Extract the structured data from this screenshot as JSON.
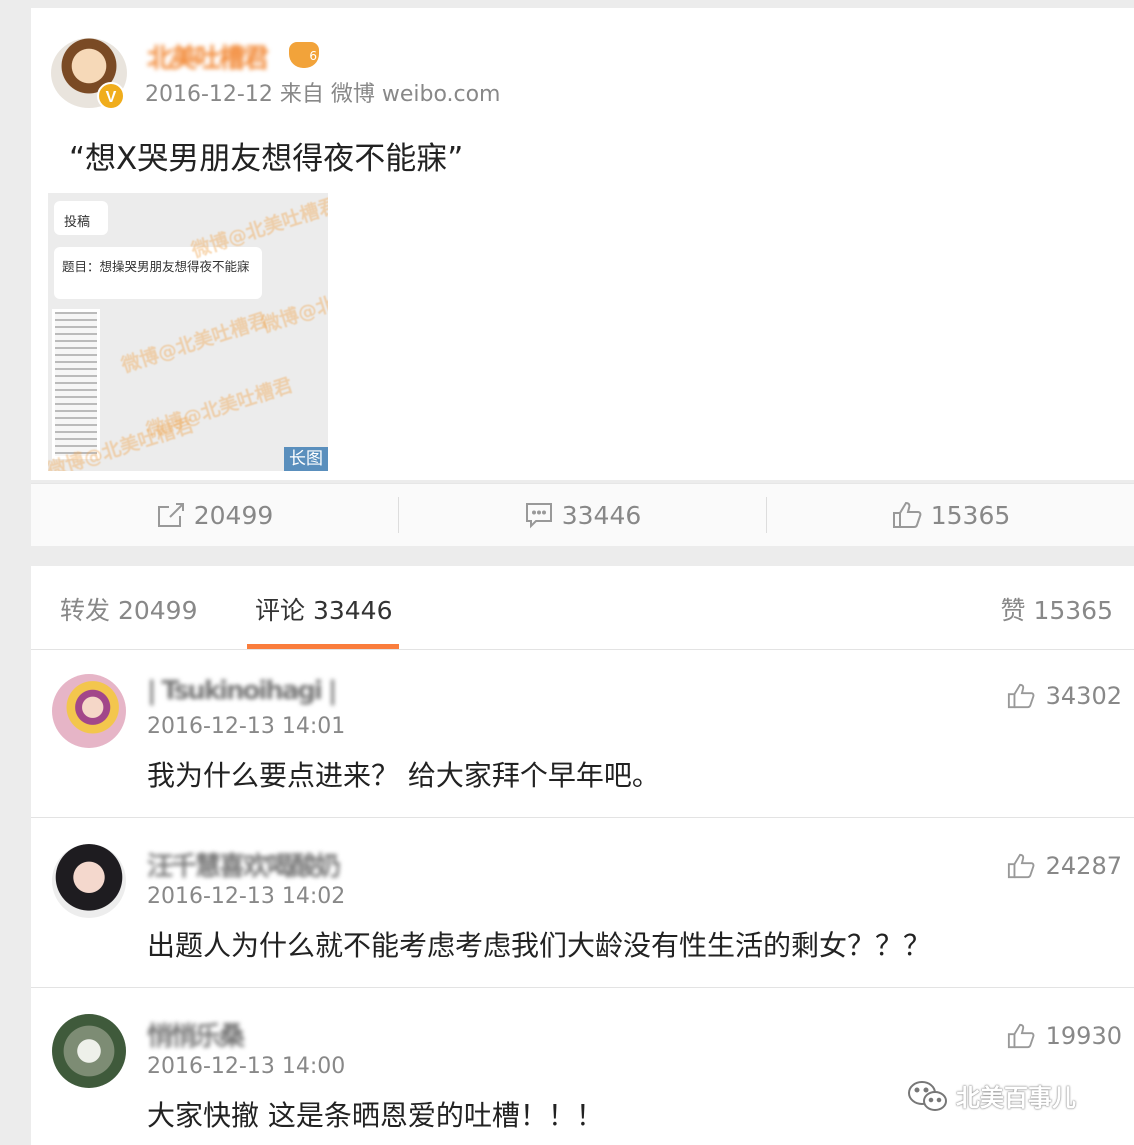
{
  "post": {
    "author_name": "北美吐槽君",
    "meta": "2016-12-12 来自 微博 weibo.com",
    "text": "“想X哭男朋友想得夜不能寐”",
    "verified_badge": "V",
    "rank_badge": "6",
    "image": {
      "label_top": "投稿",
      "label_title": "题目：想操哭男朋友想得夜不能寐",
      "watermark": "微博@北美吐槽君",
      "badge": "长图"
    }
  },
  "actions": {
    "forward_count": "20499",
    "comment_count": "33446",
    "like_count": "15365"
  },
  "tabs": {
    "forward": "转发 20499",
    "comments": "评论 33446",
    "like": "赞 15365"
  },
  "comments": [
    {
      "name": "| Tsukinoihagi |",
      "time": "2016-12-13 14:01",
      "text": "我为什么要点进来？ 给大家拜个早年吧。",
      "likes": "34302"
    },
    {
      "name": "汪千慧喜欢喝酸奶",
      "time": "2016-12-13 14:02",
      "text": "出题人为什么就不能考虑考虑我们大龄没有性生活的剩女？？？",
      "likes": "24287"
    },
    {
      "name": "悄悄乐桑",
      "time": "2016-12-13 14:00",
      "text": "大家快撤 这是条晒恩爱的吐槽！！！",
      "likes": "19930"
    }
  ],
  "brand_watermark": "北美百事儿",
  "colors": {
    "accent": "#fa7d3c",
    "page_bg": "#ececec",
    "muted_text": "#888888",
    "verified": "#f0ad1c"
  }
}
